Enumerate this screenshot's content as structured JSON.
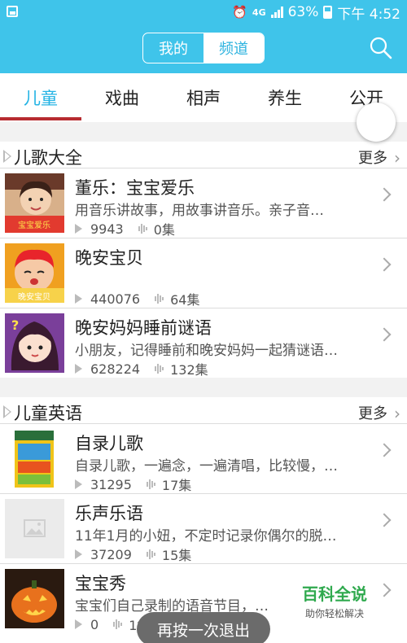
{
  "status_bar": {
    "network": "4G",
    "battery": "63%",
    "time": "下午 4:52"
  },
  "header": {
    "segment_mine": "我的",
    "segment_channel": "频道"
  },
  "tabs": [
    {
      "label": "儿童"
    },
    {
      "label": "戏曲"
    },
    {
      "label": "相声"
    },
    {
      "label": "养生"
    },
    {
      "label": "公开"
    }
  ],
  "sections": [
    {
      "title": "儿歌大全",
      "more": "更多",
      "items": [
        {
          "title": "董乐：宝宝爱乐",
          "desc": "用音乐讲故事，用故事讲音乐。亲子音…",
          "plays": "9943",
          "episodes": "0集",
          "thumb_text": "宝宝爱乐"
        },
        {
          "title": "晚安宝贝",
          "desc": "",
          "plays": "440076",
          "episodes": "64集",
          "thumb_text": "晚安宝贝"
        },
        {
          "title": "晚安妈妈睡前谜语",
          "desc": "小朋友，记得睡前和晚安妈妈一起猜谜语…",
          "plays": "628224",
          "episodes": "132集",
          "thumb_text": ""
        }
      ]
    },
    {
      "title": "儿童英语",
      "more": "更多",
      "items": [
        {
          "title": "自录儿歌",
          "desc": "自录儿歌，一遍念，一遍清唱，比较慢，…",
          "plays": "31295",
          "episodes": "17集",
          "thumb_text": ""
        },
        {
          "title": "乐声乐语",
          "desc": "11年1月的小妞，不定时记录你偶尔的脱…",
          "plays": "37209",
          "episodes": "15集",
          "thumb_text": ""
        },
        {
          "title": "宝宝秀",
          "desc": "宝宝们自己录制的语音节目，…",
          "plays": "0",
          "episodes": "1集",
          "thumb_text": ""
        }
      ]
    }
  ],
  "toast": "再按一次退出",
  "watermark": {
    "title": "百科全说",
    "subtitle": "助你轻松解决"
  },
  "colors": {
    "header_bg": "#3fc4ea",
    "active_tab": "#23b3e4",
    "tab_underline": "#b72b30",
    "watermark": "#2fa94e"
  }
}
